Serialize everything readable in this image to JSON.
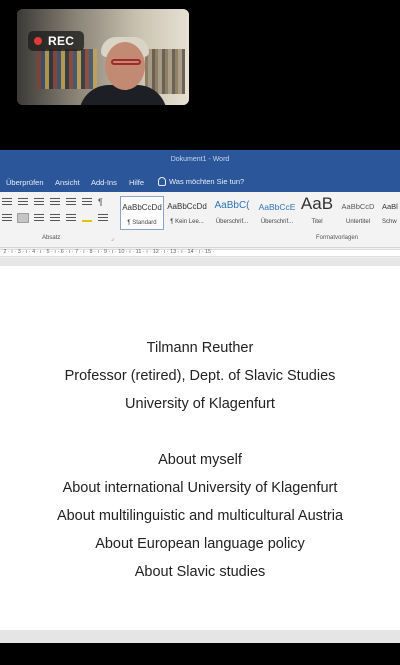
{
  "meeting": {
    "rec_label": "REC"
  },
  "word": {
    "window_title": "Dokument1  -  Word",
    "tabs": [
      "Überprüfen",
      "Ansicht",
      "Add-Ins",
      "Hilfe"
    ],
    "tell_me": "Was möchten Sie tun?",
    "styles": [
      {
        "sample": "AaBbCcDd",
        "name": "¶ Standard"
      },
      {
        "sample": "AaBbCcDd",
        "name": "¶ Kein Lee..."
      },
      {
        "sample": "AaBbC(",
        "name": "Überschrif..."
      },
      {
        "sample": "AaBbCcE",
        "name": "Überschrif..."
      },
      {
        "sample": "AaB",
        "name": "Titel"
      },
      {
        "sample": "AaBbCcD",
        "name": "Untertitel"
      },
      {
        "sample": "AaBl",
        "name": "Schw"
      }
    ],
    "group_absatz": "Absatz",
    "group_formatvorlagen": "Formatvorlagen",
    "ruler_text": "· 2 · ı · 3 · ı · 4 · ı · 5 · ı · 6 · ı · 7 · ı · 8 · ı · 9 · ı · 10 · ı · 11 · ı · 12 · ı · 13 · ı · 14 · ı · 15 ·"
  },
  "document": {
    "lines": [
      "Tilmann Reuther",
      "Professor (retired), Dept. of Slavic Studies",
      "University of Klagenfurt",
      "About myself",
      "About international University of Klagenfurt",
      "About multilinguistic and multicultural Austria",
      "About European language policy",
      "About Slavic studies"
    ]
  },
  "colors": {
    "word_blue": "#2b579a",
    "rec_red": "#e53935"
  }
}
